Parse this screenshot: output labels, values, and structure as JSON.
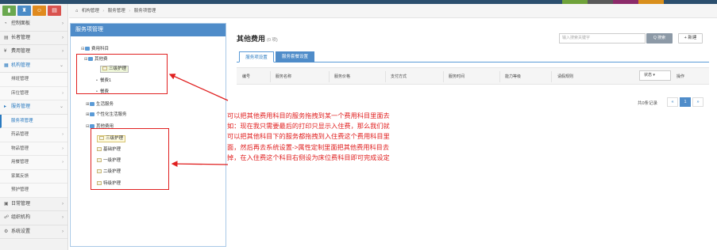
{
  "topbar": {
    "color": "#2b4f6e",
    "segments": [
      {
        "color": "#6fa23a"
      },
      {
        "color": "#5a5a5a"
      },
      {
        "color": "#8c2b6a"
      },
      {
        "color": "#d98f1c"
      }
    ]
  },
  "sidebar": {
    "tabs": [
      {
        "icon": "bar-chart-icon",
        "glyph": "▮",
        "color": "#6aa84f"
      },
      {
        "icon": "trophy-icon",
        "glyph": "♜",
        "color": "#4a8bc7"
      },
      {
        "icon": "users-icon",
        "glyph": "☺",
        "color": "#e08a1e"
      },
      {
        "icon": "tasks-icon",
        "glyph": "▤",
        "color": "#d9534f"
      }
    ],
    "items": [
      {
        "label": "控制面板",
        "icon": "dashboard-icon",
        "glyph": "◔",
        "chevron": "›"
      },
      {
        "label": "长者管理",
        "icon": "list-icon",
        "glyph": "▤",
        "chevron": "›"
      },
      {
        "label": "费用管理",
        "icon": "money-icon",
        "glyph": "¥",
        "chevron": "›"
      },
      {
        "label": "机构管理",
        "icon": "building-icon",
        "glyph": "▦",
        "chevron": "⌄",
        "active": true
      },
      {
        "label": "排班管理",
        "sub": true
      },
      {
        "label": "床位管理",
        "chevron": "›",
        "sub2": true
      },
      {
        "label": "服务管理",
        "icon": "service-icon",
        "glyph": "▸",
        "chevron": "⌄",
        "active": true
      },
      {
        "label": "服务项管理",
        "sub": true,
        "current": true
      },
      {
        "label": "药品管理",
        "chevron": "›",
        "sub2": true
      },
      {
        "label": "物品管理",
        "chevron": "›",
        "sub2": true
      },
      {
        "label": "用餐管理",
        "chevron": "›",
        "sub2": true
      },
      {
        "label": "家属反馈",
        "sub": true
      },
      {
        "label": "预护管理",
        "sub": true
      },
      {
        "label": "日常管理",
        "icon": "calendar-icon",
        "glyph": "▣",
        "chevron": "›"
      },
      {
        "label": "组织机构",
        "icon": "org-icon",
        "glyph": "☍",
        "chevron": "›"
      },
      {
        "label": "系统设置",
        "icon": "settings-icon",
        "glyph": "⚙",
        "chevron": "›"
      }
    ]
  },
  "breadcrumb": {
    "home": "机构管理",
    "b2": "服务管理",
    "b3": "服务项管理"
  },
  "tree": {
    "title": "服务项管理",
    "nodes": [
      {
        "label": "费用科目",
        "exp": "⊟",
        "ico": "folder"
      },
      {
        "label": "其他费",
        "exp": "⊟",
        "ico": "folder"
      },
      {
        "label": "三级护理",
        "ico": "file",
        "style": "drag"
      },
      {
        "label": "餐费1",
        "exp": "•",
        "ico": "none"
      },
      {
        "label": "餐费",
        "exp": "•",
        "ico": "none"
      },
      {
        "label": "生活服务",
        "exp": "⊞",
        "ico": "folder"
      },
      {
        "label": "个性化生活服务",
        "exp": "⊞",
        "ico": "folder"
      },
      {
        "label": "其他费用",
        "exp": "⊟",
        "ico": "folder"
      },
      {
        "label": "三级护理",
        "ico": "file",
        "style": "sel"
      },
      {
        "label": "基础护理",
        "ico": "file"
      },
      {
        "label": "一级护理",
        "ico": "file"
      },
      {
        "label": "二级护理",
        "ico": "file"
      },
      {
        "label": "特级护理",
        "ico": "file"
      }
    ]
  },
  "main": {
    "title": "其他费用",
    "count": "(0 项)",
    "search_placeholder": "输入搜索关键字",
    "search_btn": "Q 搜索",
    "new_btn": "+ 新建",
    "tabs": [
      {
        "label": "服务项设置",
        "active": true
      },
      {
        "label": "服务套餐设置",
        "active": false
      }
    ],
    "columns": [
      "编号",
      "服务名称",
      "服务价格",
      "支付方式",
      "服务时间",
      "能力等级",
      "请假规则",
      "状态",
      "操作"
    ],
    "status_select": "状态 ▾",
    "pager": {
      "total": "共0条记录",
      "prev": "«",
      "page": "1",
      "next": "»"
    }
  },
  "annotation": {
    "color": "#e02020",
    "lines": [
      "可以把其他费用科目的服务拖拽到某一个费用科目里面去",
      "如：现在我只需要最后的打印只显示入住费，那么我们就",
      "可以把其他科目下的服务都拖拽到入住费这个费用科目里",
      "面，然后再去系统设置->属性定制里面把其他费用科目去",
      "掉，在入住费这个科目右侧设为床位费科目即可完成设定"
    ]
  }
}
